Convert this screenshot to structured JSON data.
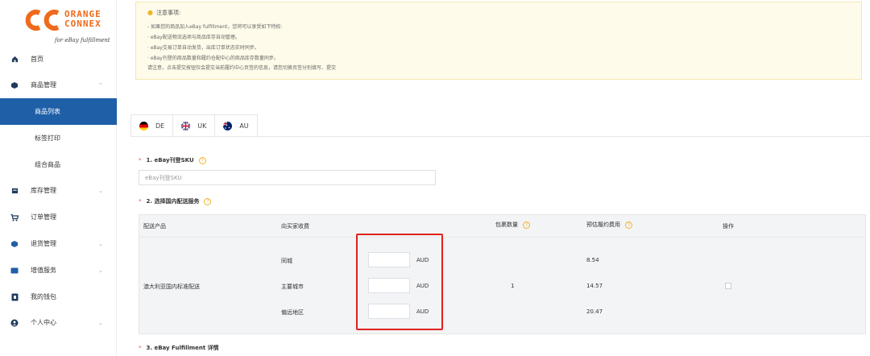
{
  "brand": {
    "line1": "ORANGE",
    "line2": "CONNEX",
    "sub": "for eBay fulfillment",
    "color": "#f06a1b"
  },
  "sidebar": {
    "items": [
      {
        "label": "首页",
        "icon": "home-icon"
      },
      {
        "label": "商品管理",
        "icon": "box-icon",
        "chevron": "^"
      },
      {
        "label": "商品列表",
        "active": true
      },
      {
        "label": "标签打印"
      },
      {
        "label": "组合商品"
      },
      {
        "label": "库存管理",
        "icon": "inventory-icon",
        "chevron": "v"
      },
      {
        "label": "订单管理",
        "icon": "cart-icon"
      },
      {
        "label": "退货管理",
        "icon": "return-icon",
        "chevron": "v"
      },
      {
        "label": "增值服务",
        "icon": "service-icon",
        "chevron": "v"
      },
      {
        "label": "我的钱包",
        "icon": "wallet-icon"
      },
      {
        "label": "个人中心",
        "icon": "user-icon",
        "chevron": "v"
      }
    ]
  },
  "notice": {
    "title": "注意事项:",
    "lines": [
      "- 如果您的商品加入eBay fulfillment，您将可以享受如下特权:",
      "· eBay配送物流选项与商品库存自动管理。",
      "· eBay交易订单自动发货，出库订单状态实时同步。",
      "· eBay刊登的商品数量和履约仓配中心的商品库存数量同步。",
      "请注意，点击提交按钮仅会提交当前履约中心页签的信息，请您切换页签分别填写、提交"
    ]
  },
  "tabs": [
    {
      "label": "DE"
    },
    {
      "label": "UK"
    },
    {
      "label": "AU"
    }
  ],
  "form": {
    "sku_label": "1. eBay刊登SKU",
    "sku_placeholder": "eBay刊登SKU",
    "shipping_label": "2. 选择国内配送服务",
    "details_label": "3. eBay Fulfillment 详情",
    "required_mark": "*",
    "help_glyph": "?"
  },
  "table": {
    "headers": {
      "product": "配送产品",
      "buyer_fee": "向买家收费",
      "package_count": "包裹数量",
      "est_fee": "预估履约费用",
      "action": "操作"
    },
    "product": "澳大利亚国内标准配送",
    "package_count": "1",
    "rows": [
      {
        "zone": "同城",
        "unit": "AUD",
        "est": "8.54"
      },
      {
        "zone": "主要城市",
        "unit": "AUD",
        "est": "14.57"
      },
      {
        "zone": "偏远地区",
        "unit": "AUD",
        "est": "20.47"
      }
    ]
  },
  "colors": {
    "accent": "#1f5fa8",
    "highlight": "#e02020",
    "warning": "#f0b429"
  }
}
